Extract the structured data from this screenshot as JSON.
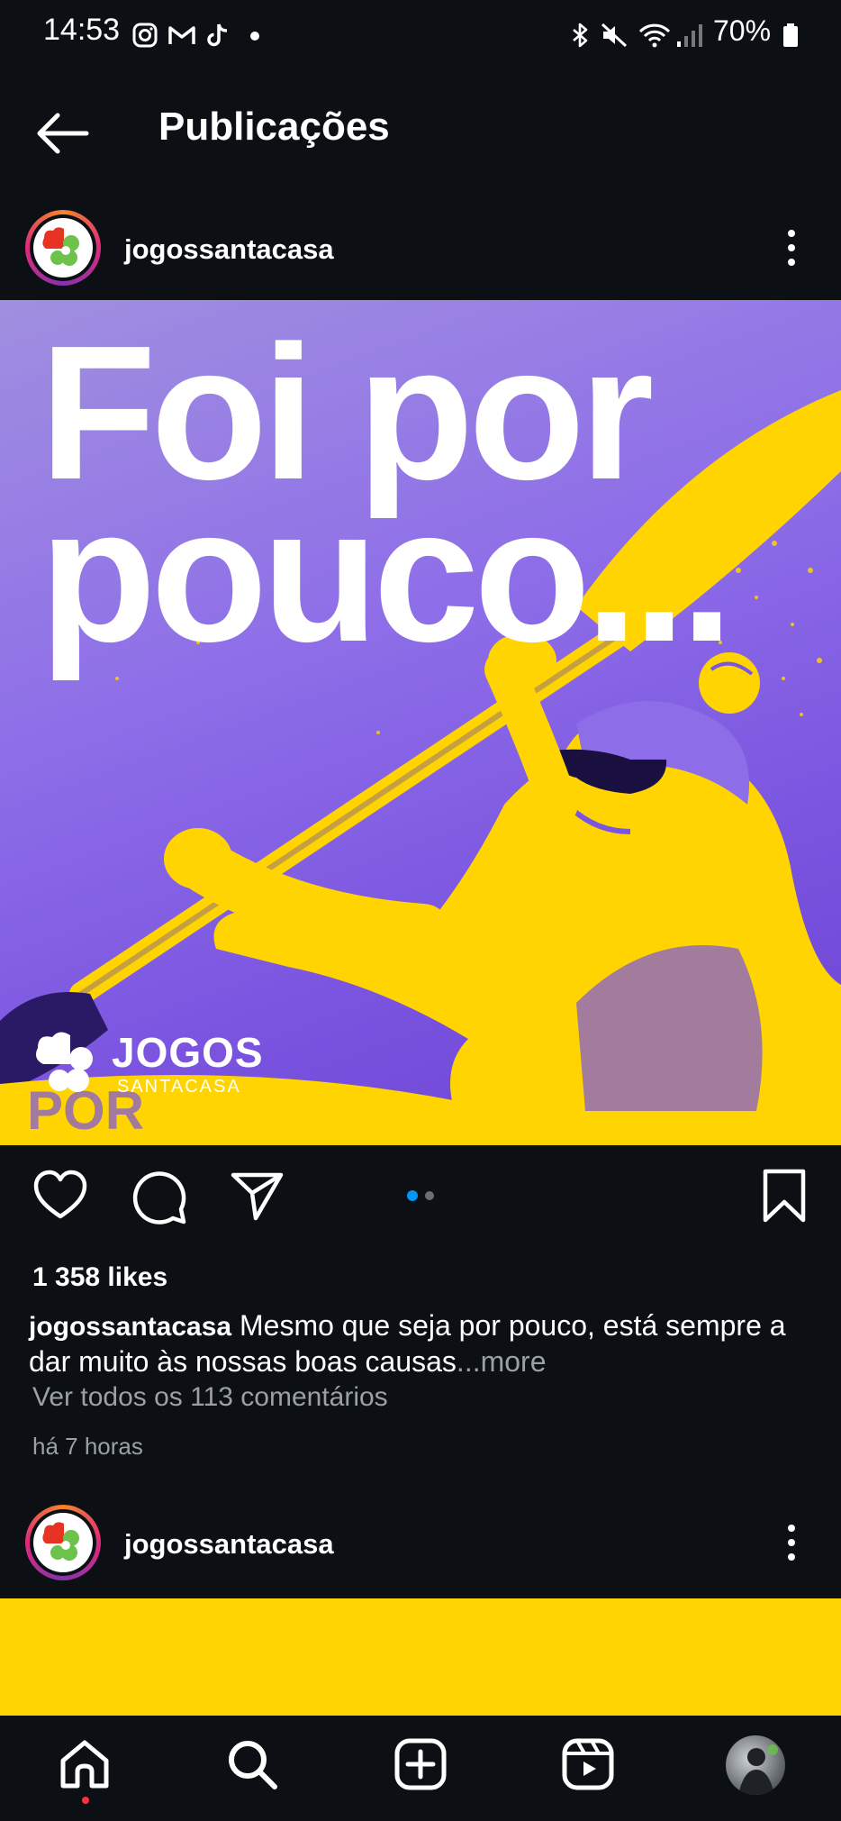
{
  "status_bar": {
    "time": "14:53",
    "left_icons": [
      "instagram-icon",
      "gmail-icon",
      "tiktok-icon",
      "dot-icon"
    ],
    "right_icons": [
      "bluetooth-icon",
      "mute-icon",
      "wifi-icon",
      "signal-icon",
      "battery-icon"
    ],
    "battery": "70%"
  },
  "header": {
    "title": "Publicações",
    "back_icon": "arrow-left-icon"
  },
  "post": {
    "username": "jogossantacasa",
    "image": {
      "headline_line1": "Foi por",
      "headline_line2": "pouco...",
      "logo_text": "JOGOS",
      "logo_subtext": "SANTACASA",
      "boat_text": "POR"
    },
    "carousel": {
      "count": 2,
      "active": 0
    },
    "likes": "1 358 likes",
    "caption_user": "jogossantacasa",
    "caption_text": " Mesmo que seja por pouco, está sempre a dar muito às nossas boas causas",
    "caption_more": "...more",
    "comments_link": "Ver todos os 113 comentários",
    "time_ago": "há 7 horas"
  },
  "next_post": {
    "username": "jogossantacasa"
  },
  "bottom_nav": {
    "items": [
      "home-icon",
      "search-icon",
      "create-icon",
      "reels-icon",
      "profile-avatar"
    ]
  },
  "colors": {
    "background": "#0c0f14",
    "accent_blue": "#0095f6",
    "purple": "#7b55e0",
    "yellow": "#ffd400",
    "muted": "#9aa0a6"
  }
}
